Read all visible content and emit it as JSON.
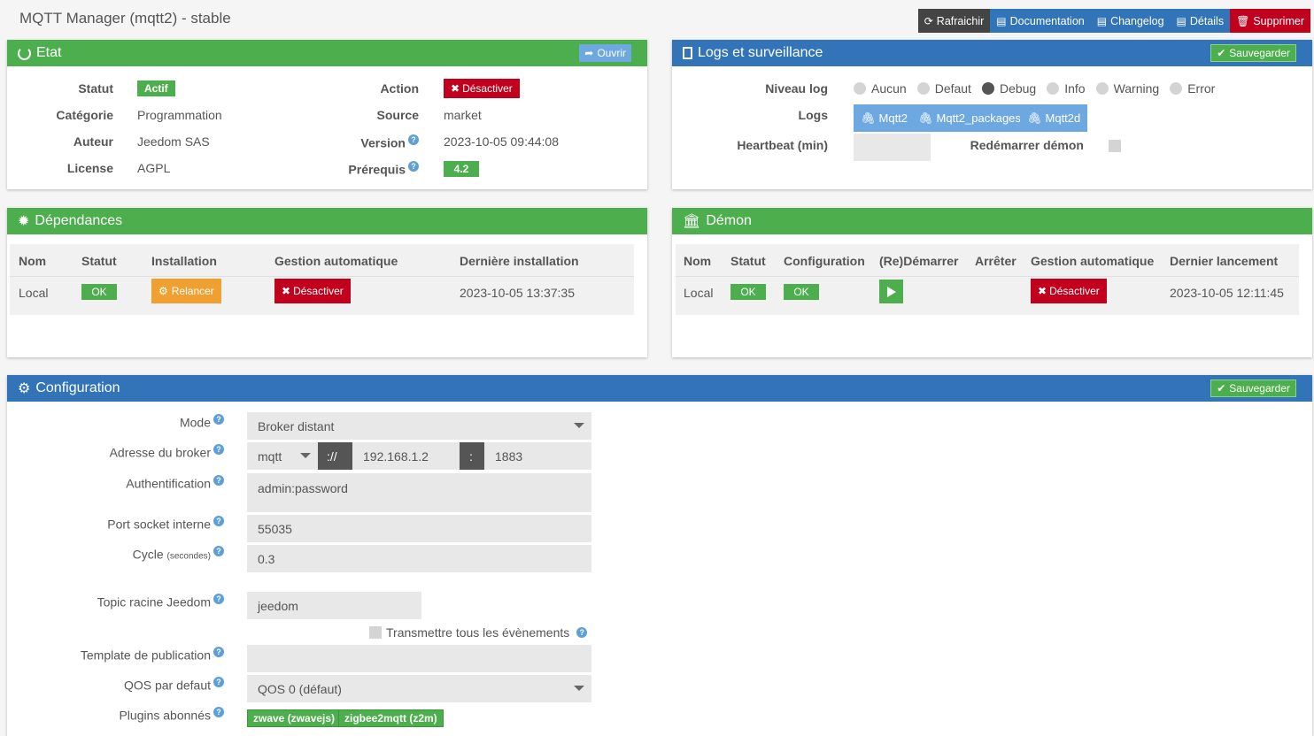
{
  "title": "MQTT Manager (mqtt2) - stable",
  "topbar": {
    "refresh": "Rafraichir",
    "documentation": "Documentation",
    "changelog": "Changelog",
    "details": "Détails",
    "delete": "Supprimer"
  },
  "etat": {
    "title": "Etat",
    "open_button": "Ouvrir",
    "statut_label": "Statut",
    "statut_value": "Actif",
    "categorie_label": "Catégorie",
    "categorie_value": "Programmation",
    "auteur_label": "Auteur",
    "auteur_value": "Jeedom SAS",
    "license_label": "License",
    "license_value": "AGPL",
    "action_label": "Action",
    "action_value": "Désactiver",
    "source_label": "Source",
    "source_value": "market",
    "version_label": "Version",
    "version_value": "2023-10-05 09:44:08",
    "prerequis_label": "Prérequis",
    "prerequis_value": "4.2"
  },
  "logs": {
    "title": "Logs et surveillance",
    "save_button": "Sauvegarder",
    "niveau_label": "Niveau log",
    "levels": [
      "Aucun",
      "Defaut",
      "Debug",
      "Info",
      "Warning",
      "Error"
    ],
    "selected_level": "Debug",
    "logs_label": "Logs",
    "log_buttons": [
      "Mqtt2",
      "Mqtt2_packages",
      "Mqtt2d"
    ],
    "heartbeat_label": "Heartbeat (min)",
    "heartbeat_value": "",
    "restart_label": "Redémarrer démon"
  },
  "dependances": {
    "title": "Dépendances",
    "headers": [
      "Nom",
      "Statut",
      "Installation",
      "Gestion automatique",
      "Dernière installation"
    ],
    "row": {
      "nom": "Local",
      "statut": "OK",
      "installation": "Relancer",
      "gestion": "Désactiver",
      "derniere": "2023-10-05 13:37:35"
    }
  },
  "demon": {
    "title": "Démon",
    "headers": [
      "Nom",
      "Statut",
      "Configuration",
      "(Re)Démarrer",
      "Arrêter",
      "Gestion automatique",
      "Dernier lancement"
    ],
    "row": {
      "nom": "Local",
      "statut": "OK",
      "configuration": "OK",
      "gestion": "Désactiver",
      "dernier": "2023-10-05 12:11:45"
    }
  },
  "configuration": {
    "title": "Configuration",
    "save_button": "Sauvegarder",
    "mode_label": "Mode",
    "mode_value": "Broker distant",
    "broker_label": "Adresse du broker",
    "broker_protocol": "mqtt",
    "broker_separator": "://",
    "broker_host": "192.168.1.2",
    "broker_colon": ":",
    "broker_port": "1883",
    "auth_label": "Authentification",
    "auth_value": "admin:password",
    "socket_label": "Port socket interne",
    "socket_value": "55035",
    "cycle_label": "Cycle",
    "cycle_unit": "(secondes)",
    "cycle_value": "0.3",
    "topic_label": "Topic racine Jeedom",
    "topic_value": "jeedom",
    "transmit_label": "Transmettre tous les évènements",
    "template_label": "Template de publication",
    "template_value": "",
    "qos_label": "QOS par defaut",
    "qos_value": "QOS 0 (défaut)",
    "plugins_label": "Plugins abonnés",
    "plugins": [
      "zwave (zwavejs)",
      "zigbee2mqtt (z2m)"
    ]
  }
}
